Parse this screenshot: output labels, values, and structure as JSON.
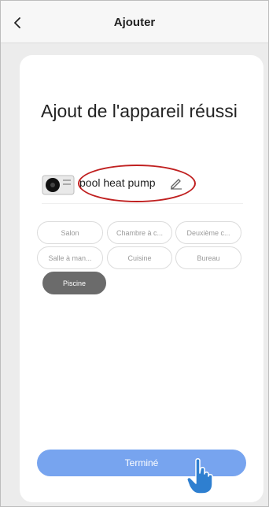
{
  "header": {
    "back_icon": "chevron-left-icon",
    "title": "Ajouter"
  },
  "main": {
    "headline": "Ajout de l'appareil réussi",
    "device": {
      "image_icon": "heat-pump-device-icon",
      "name": "pool heat pump",
      "edit_icon": "pencil-icon"
    },
    "rooms": [
      {
        "label": "Salon",
        "selected": false
      },
      {
        "label": "Chambre à c...",
        "selected": false
      },
      {
        "label": "Deuxième c...",
        "selected": false
      },
      {
        "label": "Salle à man...",
        "selected": false
      },
      {
        "label": "Cuisine",
        "selected": false
      },
      {
        "label": "Bureau",
        "selected": false
      },
      {
        "label": "Piscine",
        "selected": true
      }
    ],
    "done_label": "Terminé"
  },
  "colors": {
    "accent": "#77a4ef",
    "selected_chip": "#6b6b6b",
    "annotation": "#c02020"
  }
}
